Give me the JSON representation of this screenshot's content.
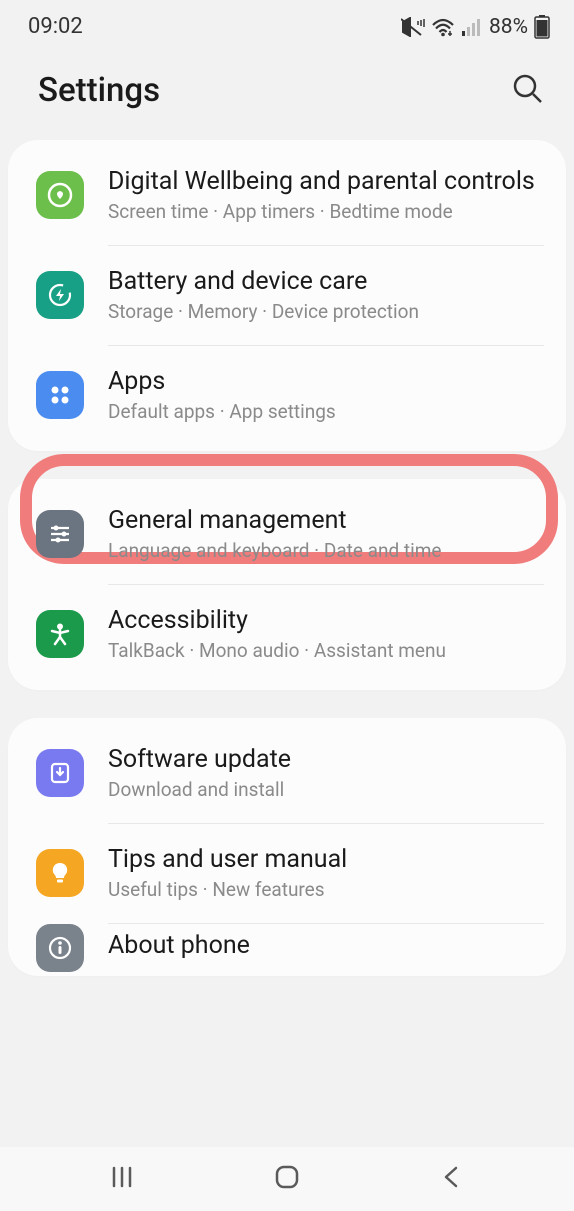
{
  "status": {
    "time": "09:02",
    "battery": "88%"
  },
  "header": {
    "title": "Settings"
  },
  "groups": [
    {
      "items": [
        {
          "title": "Digital Wellbeing and parental controls",
          "sub": "Screen time  ·  App timers  ·  Bedtime mode",
          "iconBg": "#6cbf4b",
          "icon": "wellbeing"
        },
        {
          "title": "Battery and device care",
          "sub": "Storage  ·  Memory  ·  Device protection",
          "iconBg": "#17a085",
          "icon": "battery-care"
        },
        {
          "title": "Apps",
          "sub": "Default apps  ·  App settings",
          "iconBg": "#4a8cf0",
          "icon": "apps",
          "highlighted": true
        }
      ]
    },
    {
      "items": [
        {
          "title": "General management",
          "sub": "Language and keyboard  ·  Date and time",
          "iconBg": "#6b7582",
          "icon": "sliders"
        },
        {
          "title": "Accessibility",
          "sub": "TalkBack  ·  Mono audio  ·  Assistant menu",
          "iconBg": "#1a9a4a",
          "icon": "person"
        }
      ]
    },
    {
      "items": [
        {
          "title": "Software update",
          "sub": "Download and install",
          "iconBg": "#7a7af0",
          "icon": "update"
        },
        {
          "title": "Tips and user manual",
          "sub": "Useful tips  ·  New features",
          "iconBg": "#f5a623",
          "icon": "bulb"
        },
        {
          "title": "About phone",
          "sub": "",
          "iconBg": "#7a828c",
          "icon": "info"
        }
      ]
    }
  ]
}
